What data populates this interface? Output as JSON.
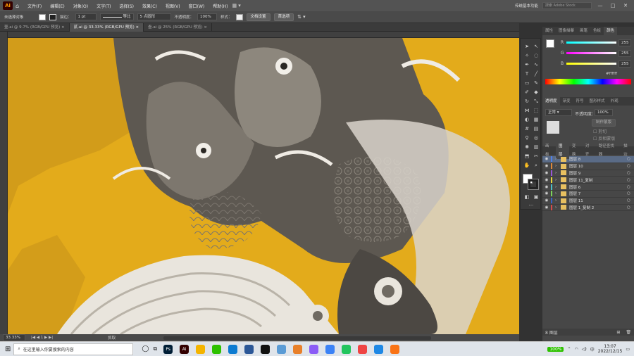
{
  "app": {
    "logo": "Ai"
  },
  "menu": [
    "文件(F)",
    "编辑(E)",
    "对象(O)",
    "文字(T)",
    "选择(S)",
    "效果(C)",
    "视图(V)",
    "窗口(W)",
    "帮助(H)"
  ],
  "workspace": "传统基本功能",
  "search_placeholder": "搜索 Adobe Stock",
  "window_controls": [
    "—",
    "□",
    "✕"
  ],
  "control_bar": {
    "selection": "未选择对象",
    "stroke_label": "描边：",
    "stroke_value": "1 pt",
    "brush_label": "等比",
    "brush2": "5 点圆形",
    "opacity_label": "不透明度：",
    "opacity_value": "100%",
    "style_label": "样式：",
    "doc_setup": "文档设置",
    "prefs": "首选项"
  },
  "tabs": [
    "壹.ai @ 9.7% (RGB/GPU 预览)",
    "贰.ai @ 33.33% (RGB/GPU 预览)",
    "叁.ai @ 25% (RGB/GPU 预览)"
  ],
  "status": {
    "zoom": "33.33%",
    "page": "1",
    "tool": "抓取"
  },
  "color_panel": {
    "tabs": [
      "属性",
      "图像描摹",
      "画笔",
      "色板",
      "颜色"
    ],
    "sliders": [
      {
        "label": "R",
        "value": "255"
      },
      {
        "label": "G",
        "value": "255"
      },
      {
        "label": "B",
        "value": "255"
      }
    ],
    "hex": "ffffff"
  },
  "transparency_panel": {
    "tabs": [
      "透明度",
      "渐变",
      "符号",
      "图形样式",
      "外观"
    ],
    "mode": "正常",
    "opacity_label": "不透明度：",
    "opacity_value": "100%",
    "buttons": [
      "制作蒙版",
      "剪切",
      "反相蒙版"
    ]
  },
  "layers_panel": {
    "tabs": [
      "画板",
      "图层",
      "变换",
      "对齐",
      "路径查找器",
      "描边"
    ],
    "layers": [
      {
        "name": "图层 8",
        "color": "#4f7fe8",
        "selected": true
      },
      {
        "name": "图层 10",
        "color": "#e0883a",
        "selected": false
      },
      {
        "name": "图层 9",
        "color": "#9a55d8",
        "selected": false
      },
      {
        "name": "图层 11_复制",
        "color": "#e8d83a",
        "selected": false
      },
      {
        "name": "图层 6",
        "color": "#49c0c8",
        "selected": false
      },
      {
        "name": "图层 7",
        "color": "#7bd35a",
        "selected": false
      },
      {
        "name": "图层 11",
        "color": "#3a62c8",
        "selected": false
      },
      {
        "name": "图层 1_复制 2",
        "color": "#d84a4a",
        "selected": false
      }
    ],
    "count": "8 图层"
  },
  "taskbar": {
    "search_placeholder": "在这里输入你要搜索的内容",
    "apps": [
      {
        "name": "ps",
        "color": "#001e36",
        "label": "Ps"
      },
      {
        "name": "ai",
        "color": "#330000",
        "label": "Ai"
      },
      {
        "name": "chrome",
        "color": "#f4b400",
        "label": ""
      },
      {
        "name": "wechat",
        "color": "#2dc100",
        "label": ""
      },
      {
        "name": "edge",
        "color": "#0c7bd1",
        "label": ""
      },
      {
        "name": "photos",
        "color": "#2b5797",
        "label": ""
      },
      {
        "name": "qq",
        "color": "#111111",
        "label": ""
      },
      {
        "name": "app8",
        "color": "#5a9bd5",
        "label": ""
      },
      {
        "name": "app9",
        "color": "#e8802a",
        "label": ""
      },
      {
        "name": "app10",
        "color": "#8b5cf6",
        "label": ""
      },
      {
        "name": "app11",
        "color": "#3b82f6",
        "label": ""
      },
      {
        "name": "app12",
        "color": "#22c55e",
        "label": ""
      },
      {
        "name": "app13",
        "color": "#ef4444",
        "label": ""
      },
      {
        "name": "app14",
        "color": "#1e88e5",
        "label": ""
      },
      {
        "name": "app15",
        "color": "#f97316",
        "label": ""
      }
    ],
    "battery": "100%",
    "time": "13:07",
    "date": "2022/12/15"
  }
}
